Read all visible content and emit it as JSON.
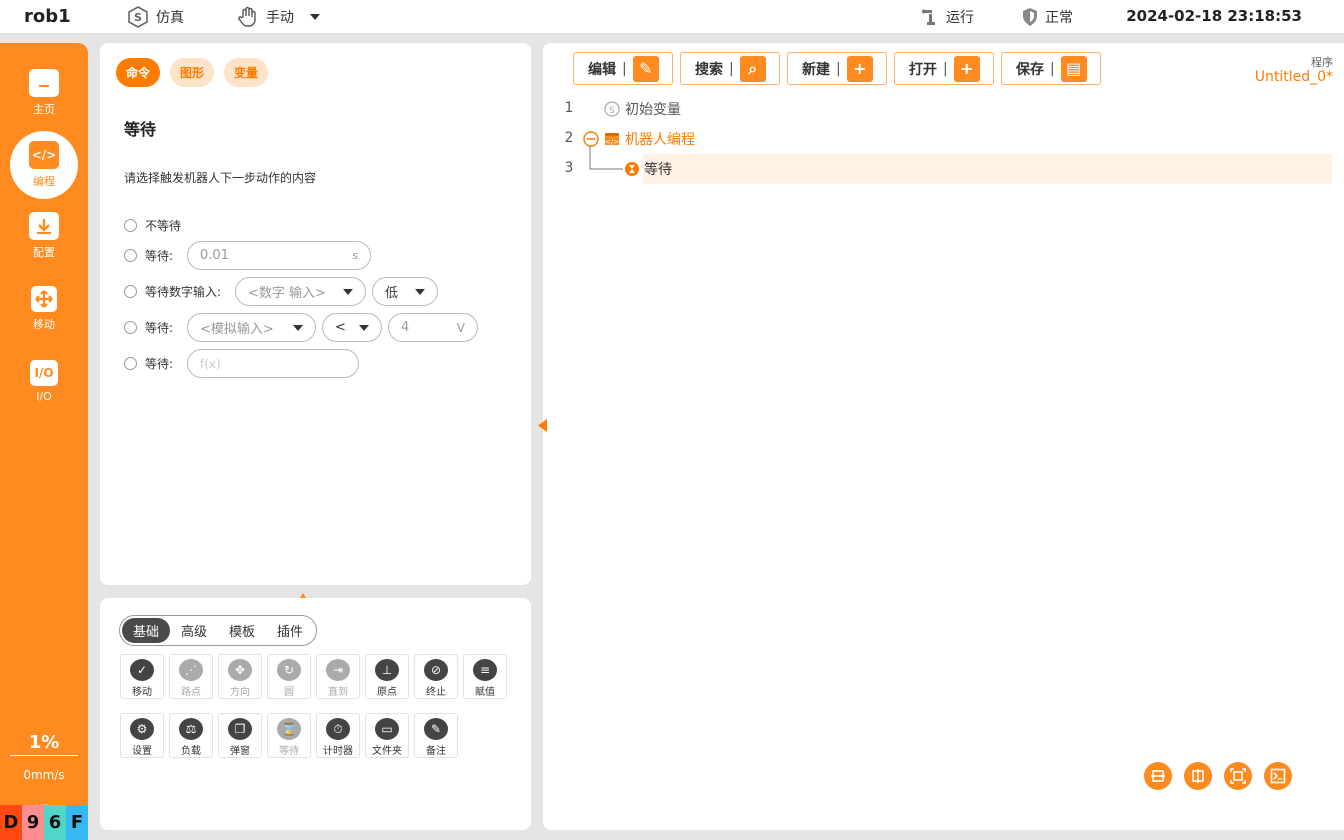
{
  "topbar": {
    "robot_name": "rob1",
    "sim_label": "仿真",
    "manual_label": "手动",
    "run_label": "运行",
    "status_label": "正常",
    "datetime": "2024-02-18 23:18:53"
  },
  "sidebar": {
    "items": [
      {
        "label": "主页",
        "icon": "home-icon"
      },
      {
        "label": "编程",
        "icon": "code-icon"
      },
      {
        "label": "配置",
        "icon": "download-icon"
      },
      {
        "label": "移动",
        "icon": "move-icon"
      },
      {
        "label": "I/O",
        "icon": "io-icon"
      }
    ],
    "io_icon_text": "I/O",
    "speed_percent": "1%",
    "speed_mm": "0mm/s",
    "status_chars": [
      {
        "char": "D",
        "color": "#ff4a14"
      },
      {
        "char": "9",
        "color": "#ff8e8e"
      },
      {
        "char": "6",
        "color": "#4fd6c8"
      },
      {
        "char": "F",
        "color": "#38b8f2"
      }
    ]
  },
  "command_panel": {
    "tabs": [
      "命令",
      "图形",
      "变量"
    ],
    "active_tab": "命令",
    "title": "等待",
    "description": "请选择触发机器人下一步动作的内容",
    "options": {
      "no_wait": "不等待",
      "wait_time_label": "等待:",
      "wait_time_value": "0.01",
      "wait_time_unit": "s",
      "wait_digital_label": "等待数字输入:",
      "digital_input_select": "<数字 输入>",
      "digital_level_select": "低",
      "wait_analog_label": "等待:",
      "analog_input_select": "<模拟输入>",
      "analog_op_select": "<",
      "analog_value": "4",
      "analog_unit": "V",
      "wait_expr_label": "等待:",
      "expr_placeholder": "f(x)"
    }
  },
  "toolbox": {
    "tabs": [
      "基础",
      "高级",
      "模板",
      "插件"
    ],
    "active_tab": "基础",
    "row1": [
      {
        "label": "移动",
        "icon": "move-tool-icon",
        "glyph": "✓",
        "enabled": true
      },
      {
        "label": "路点",
        "icon": "waypoint-icon",
        "glyph": "⋰",
        "enabled": false
      },
      {
        "label": "方向",
        "icon": "direction-icon",
        "glyph": "✥",
        "enabled": false
      },
      {
        "label": "圆",
        "icon": "circle-icon",
        "glyph": "↻",
        "enabled": false
      },
      {
        "label": "直到",
        "icon": "until-icon",
        "glyph": "⇥",
        "enabled": false
      },
      {
        "label": "原点",
        "icon": "origin-icon",
        "glyph": "⊥",
        "enabled": true
      },
      {
        "label": "终止",
        "icon": "stop-icon",
        "glyph": "⊘",
        "enabled": true
      },
      {
        "label": "赋值",
        "icon": "assign-icon",
        "glyph": "≡",
        "enabled": true
      }
    ],
    "row2": [
      {
        "label": "设置",
        "icon": "settings-icon",
        "glyph": "⚙",
        "enabled": true
      },
      {
        "label": "负载",
        "icon": "payload-icon",
        "glyph": "⚖",
        "enabled": true
      },
      {
        "label": "弹窗",
        "icon": "popup-icon",
        "glyph": "❐",
        "enabled": true
      },
      {
        "label": "等待",
        "icon": "hourglass-icon",
        "glyph": "⌛",
        "enabled": false
      },
      {
        "label": "计时器",
        "icon": "timer-icon",
        "glyph": "⏱",
        "enabled": true
      },
      {
        "label": "文件夹",
        "icon": "folder-icon",
        "glyph": "▭",
        "enabled": true
      },
      {
        "label": "备注",
        "icon": "note-icon",
        "glyph": "✎",
        "enabled": true
      }
    ]
  },
  "program": {
    "toolbar": [
      {
        "label": "编辑",
        "icon": "edit-icon",
        "glyph": "✎"
      },
      {
        "label": "搜索",
        "icon": "search-icon",
        "glyph": "⌕"
      },
      {
        "label": "新建",
        "icon": "new-file-icon",
        "glyph": "+"
      },
      {
        "label": "打开",
        "icon": "open-folder-icon",
        "glyph": "+"
      },
      {
        "label": "保存",
        "icon": "save-icon",
        "glyph": "▤"
      }
    ],
    "label": "程序",
    "name": "Untitled_0*",
    "lines": [
      {
        "num": "1",
        "text": "初始变量"
      },
      {
        "num": "2",
        "text": "机器人编程"
      },
      {
        "num": "3",
        "text": "等待"
      }
    ]
  }
}
